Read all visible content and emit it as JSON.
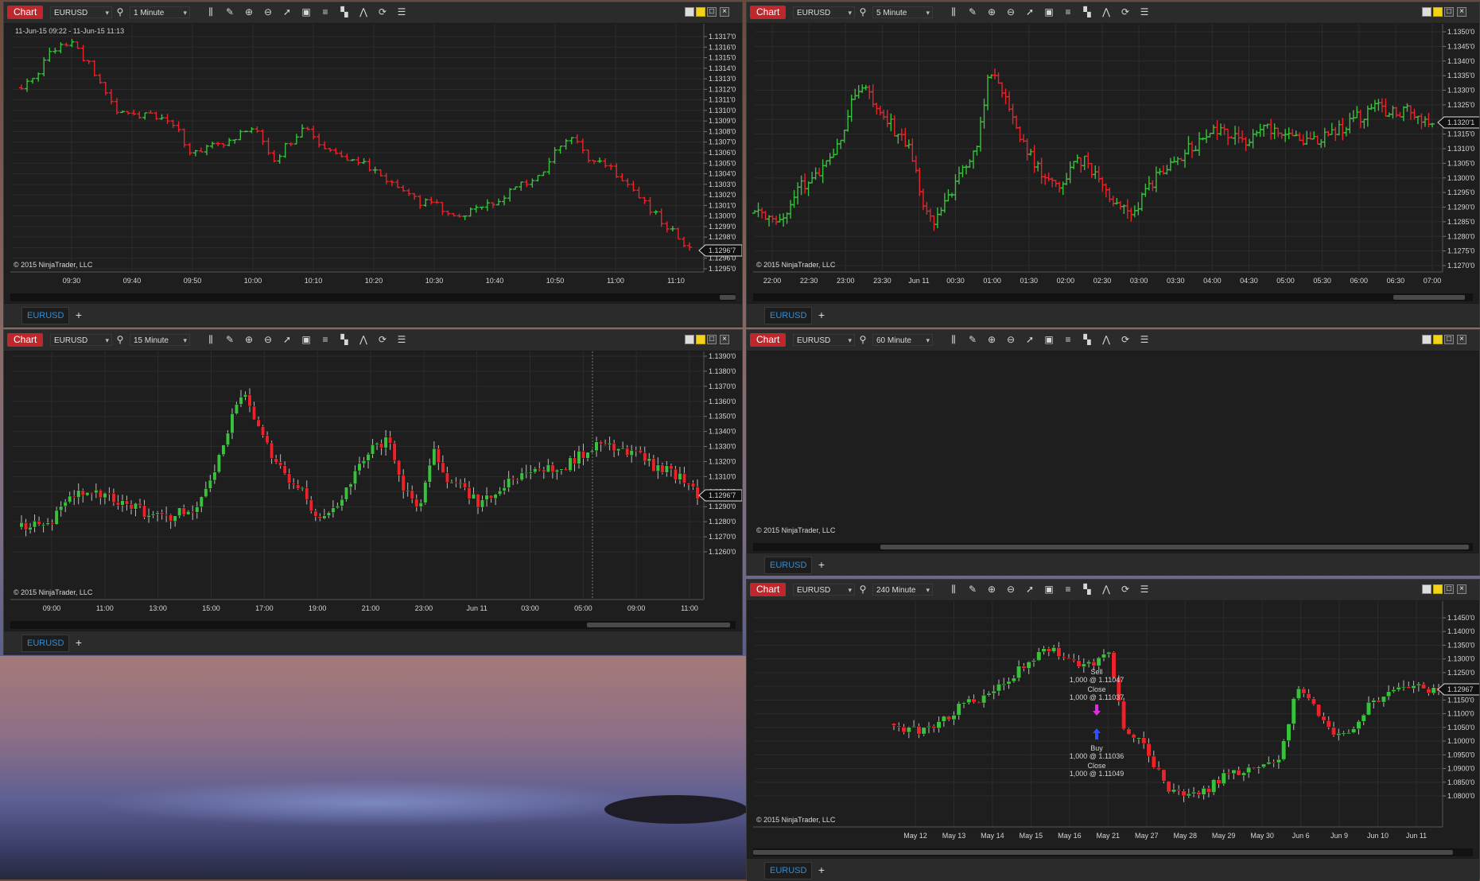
{
  "copyright": "© 2015 NinjaTrader, LLC",
  "chart_label": "Chart",
  "tab_label": "EURUSD",
  "add_tab": "+",
  "colors": {
    "up": "#39c13e",
    "down": "#e8232a",
    "background": "#1e1e1e",
    "grid": "#2e2e2e",
    "chart_label_bg": "#c0272d"
  },
  "windows": [
    {
      "instrument": "EURUSD",
      "timeframe": "1 Minute",
      "date_range": "11-Jun-15 09:22 - 11-Jun-15 11:13",
      "last_price": "1.1296'7",
      "price_ticks": [
        "1.1317'0",
        "1.1316'0",
        "1.1315'0",
        "1.1314'0",
        "1.1313'0",
        "1.1312'0",
        "1.1311'0",
        "1.1310'0",
        "1.1309'0",
        "1.1308'0",
        "1.1307'0",
        "1.1306'0",
        "1.1305'0",
        "1.1304'0",
        "1.1303'0",
        "1.1302'0",
        "1.1301'0",
        "1.1300'0",
        "1.1299'0",
        "1.1298'0",
        "1.1297'0",
        "1.1296'0",
        "1.1295'0"
      ],
      "time_ticks": [
        "09:30",
        "09:40",
        "09:50",
        "10:00",
        "10:10",
        "10:20",
        "10:30",
        "10:40",
        "10:50",
        "11:00",
        "11:10"
      ]
    },
    {
      "instrument": "EURUSD",
      "timeframe": "5 Minute",
      "last_price": "1.1320'1",
      "price_ticks": [
        "1.1350'0",
        "1.1345'0",
        "1.1340'0",
        "1.1335'0",
        "1.1330'0",
        "1.1325'0",
        "1.1320'0",
        "1.1315'0",
        "1.1310'0",
        "1.1305'0",
        "1.1300'0",
        "1.1295'0",
        "1.1290'0",
        "1.1285'0",
        "1.1280'0",
        "1.1275'0",
        "1.1270'0"
      ],
      "time_ticks": [
        "22:00",
        "22:30",
        "23:00",
        "23:30",
        "Jun 11",
        "00:30",
        "01:00",
        "01:30",
        "02:00",
        "02:30",
        "03:00",
        "03:30",
        "04:00",
        "04:30",
        "05:00",
        "05:30",
        "06:00",
        "06:30",
        "07:00"
      ]
    },
    {
      "instrument": "EURUSD",
      "timeframe": "15 Minute",
      "last_price": "1.1296'7",
      "price_ticks": [
        "1.1390'0",
        "1.1380'0",
        "1.1370'0",
        "1.1360'0",
        "1.1350'0",
        "1.1340'0",
        "1.1330'0",
        "1.1320'0",
        "1.1310'0",
        "1.1300'0",
        "1.1290'0",
        "1.1280'0",
        "1.1270'0",
        "1.1260'0"
      ],
      "time_ticks": [
        "09:00",
        "11:00",
        "13:00",
        "15:00",
        "17:00",
        "19:00",
        "21:00",
        "23:00",
        "Jun 11",
        "03:00",
        "05:00",
        "09:00",
        "11:00"
      ]
    },
    {
      "instrument": "EURUSD",
      "timeframe": "60 Minute"
    },
    {
      "instrument": "EURUSD",
      "timeframe": "240 Minute",
      "last_price": "1.12967",
      "price_ticks": [
        "1.1450'0",
        "1.1400'0",
        "1.1350'0",
        "1.1300'0",
        "1.1250'0",
        "1.1200'0",
        "1.1150'0",
        "1.1100'0",
        "1.1050'0",
        "1.1000'0",
        "1.0950'0",
        "1.0900'0",
        "1.0850'0",
        "1.0800'0"
      ],
      "time_ticks": [
        "May 12",
        "May 13",
        "May 14",
        "May 15",
        "May 16",
        "May 21",
        "May 27",
        "May 28",
        "May 29",
        "May 30",
        "Jun 6",
        "Jun 9",
        "Jun 10",
        "Jun 11"
      ],
      "trades": [
        {
          "label": "Sell",
          "detail": "1,000 @ 1.11047"
        },
        {
          "label": "Close",
          "detail": "1,000 @ 1.11037"
        },
        {
          "label": "Buy",
          "detail": "1,000 @ 1.11036"
        },
        {
          "label": "Close",
          "detail": "1,000 @ 1.11049"
        }
      ]
    }
  ]
}
